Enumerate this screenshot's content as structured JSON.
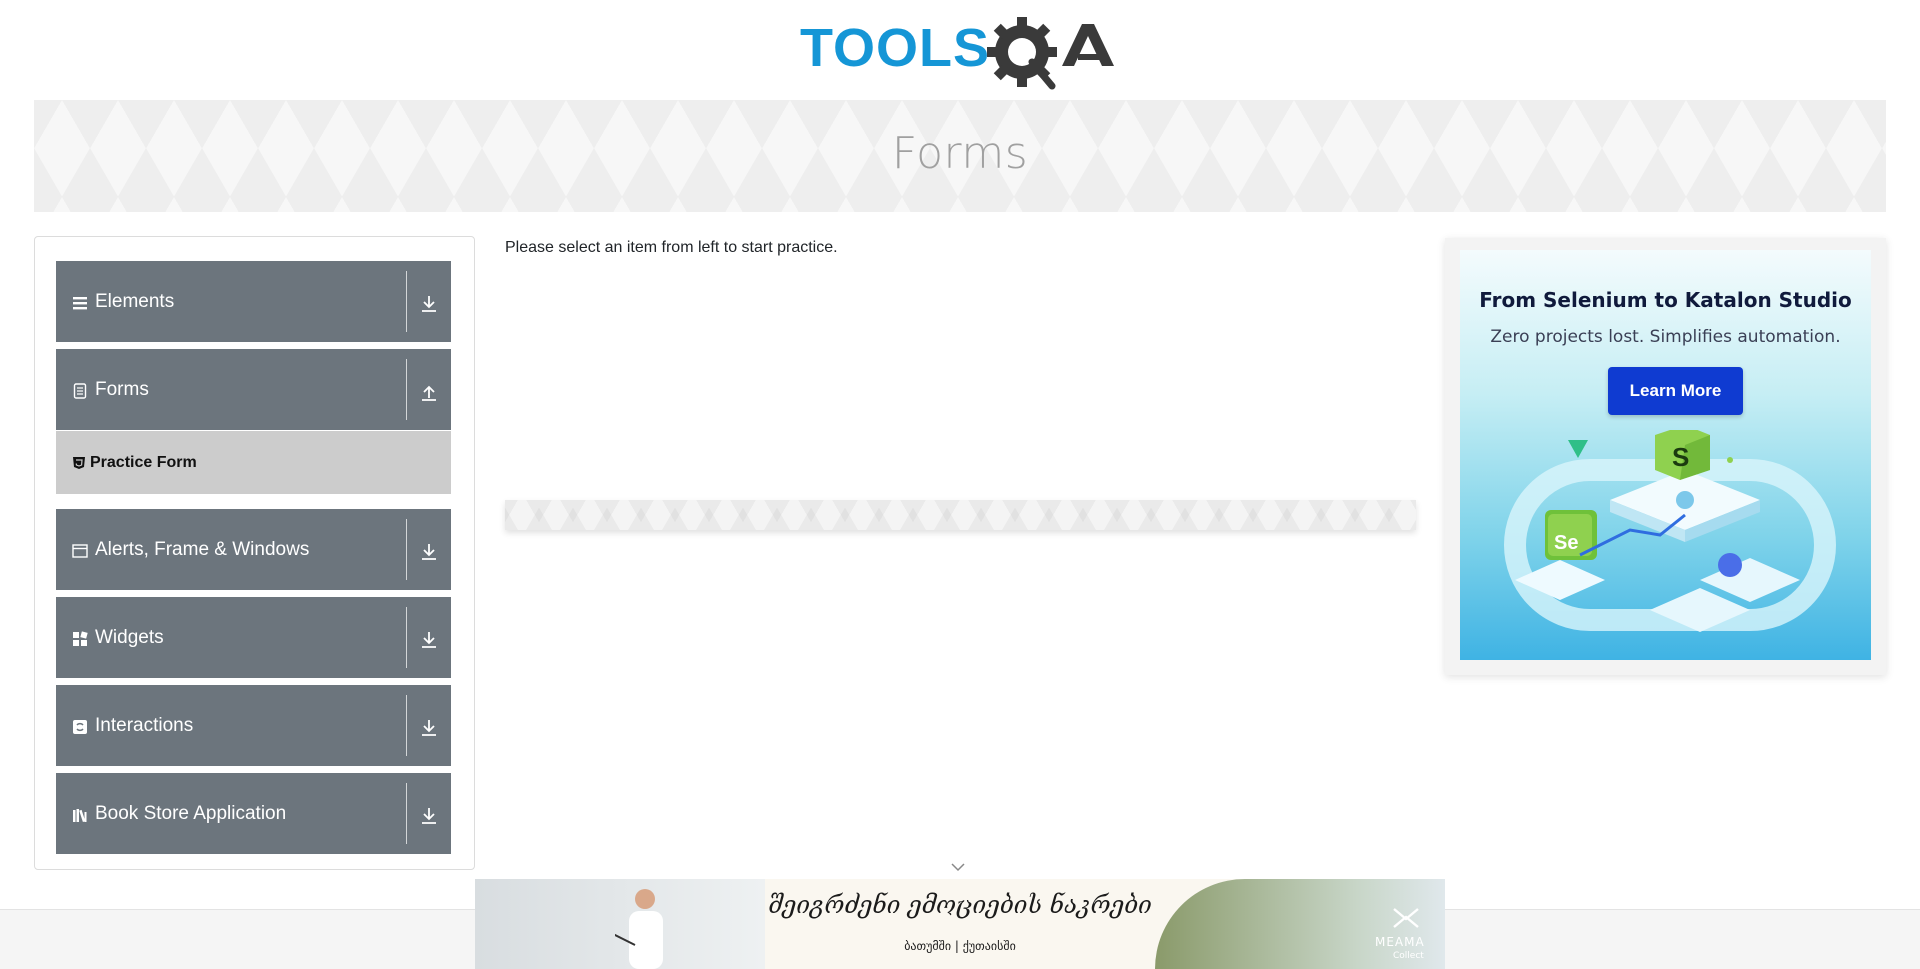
{
  "header": {
    "logo_text_blue": "TOOLS",
    "logo_text_dark": "QA"
  },
  "banner": {
    "title": "Forms"
  },
  "sidebar": {
    "groups": [
      {
        "label": "Elements",
        "icon": "hamburger-icon",
        "state": "collapsed"
      },
      {
        "label": "Forms",
        "icon": "document-icon",
        "state": "expanded"
      },
      {
        "label": "Alerts, Frame & Windows",
        "icon": "window-icon",
        "state": "collapsed"
      },
      {
        "label": "Widgets",
        "icon": "widgets-icon",
        "state": "collapsed"
      },
      {
        "label": "Interactions",
        "icon": "interactions-icon",
        "state": "collapsed"
      },
      {
        "label": "Book Store Application",
        "icon": "books-icon",
        "state": "collapsed"
      }
    ],
    "active_item": {
      "label": "Practice Form",
      "icon": "html5-icon"
    }
  },
  "main": {
    "instruction": "Please select an item from left to start practice."
  },
  "right_ad": {
    "title": "From Selenium to Katalon Studio",
    "subtitle": "Zero projects lost. Simplifies automation.",
    "button_label": "Learn More",
    "accent_color": "#0f3bd1",
    "badge_s": "S",
    "badge_se": "Se"
  },
  "bottom_ad": {
    "title": "შეიგრძენი ემოციების ნაკრები",
    "subtitle": "ბათუმში | ქუთაისში",
    "brand": "MEAMA",
    "brand_sub": "Collect"
  },
  "colors": {
    "sidebar_header": "#6c757d",
    "active_item_bg": "#cccccc",
    "logo_blue": "#1596d6",
    "logo_dark": "#3a3a3a"
  }
}
